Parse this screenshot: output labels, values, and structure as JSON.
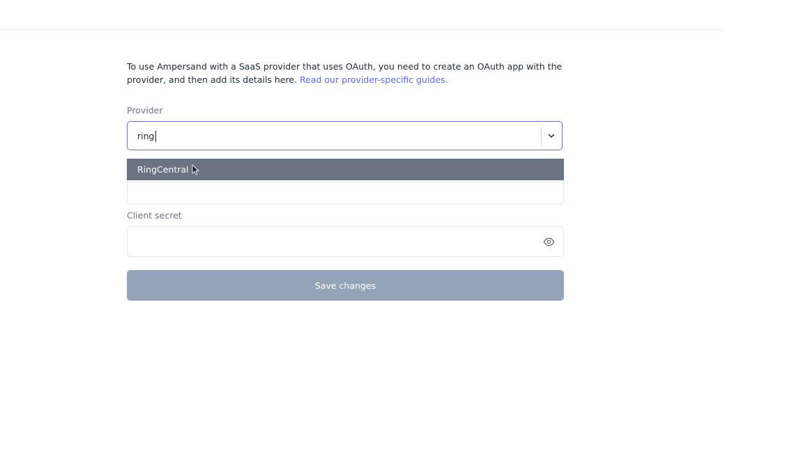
{
  "intro": {
    "text": "To use Ampersand with a SaaS provider that uses OAuth, you need to create an OAuth app with the provider, and then add its details here. ",
    "link_text": "Read our provider-specific guides."
  },
  "provider": {
    "label": "Provider",
    "value": "ring",
    "options": [
      "RingCentral"
    ],
    "highlighted_option": "RingCentral"
  },
  "client_secret": {
    "label": "Client secret",
    "value": ""
  },
  "save_button": {
    "label": "Save changes",
    "disabled": true
  },
  "colors": {
    "accent": "#6366f1",
    "focus_border": "#6b6fc9",
    "option_highlight": "#6b7280",
    "button_disabled": "#94a3b8"
  },
  "icons": {
    "dropdown": "chevron-down-icon",
    "visibility": "eye-icon",
    "pointer": "mouse-pointer-icon"
  }
}
